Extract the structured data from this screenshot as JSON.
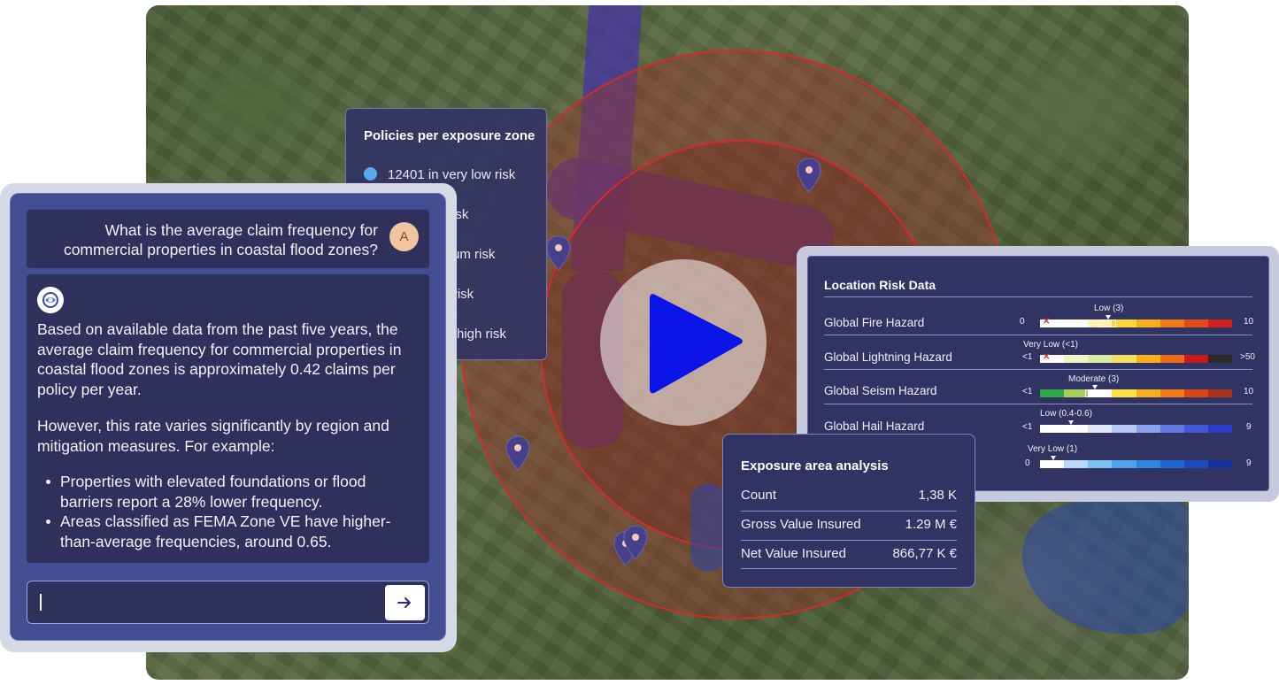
{
  "policies_panel": {
    "title": "Policies per exposure zone",
    "items": [
      {
        "label": "12401 in very low risk",
        "color": "#5aa8f0"
      },
      {
        "label": "w risk"
      },
      {
        "label": "edium risk"
      },
      {
        "label": "gh risk"
      },
      {
        "label": "ery high risk"
      }
    ]
  },
  "chat": {
    "question": "What is the average claim frequency for commercial properties in coastal flood zones?",
    "avatar_initial": "A",
    "answer_p1": "Based on available data from the past five years, the average claim frequency for commercial properties in coastal flood zones is approximately 0.42 claims per policy per year.",
    "answer_p2": "However, this rate varies significantly by region and mitigation measures. For example:",
    "answer_bullets": [
      "Properties with elevated foundations or flood barriers report a 28% lower frequency.",
      "Areas classified as FEMA Zone VE have higher-than-average frequencies, around 0.65."
    ],
    "input_value": "",
    "send_icon": "arrow-right-icon"
  },
  "location_risk": {
    "title": "Location Risk Data",
    "rows": [
      {
        "label": "Global Fire Hazard",
        "caption": "Low (3)",
        "min": "0",
        "max": "10",
        "level": 0.3,
        "colors": [
          "#ffffff",
          "#ffffff",
          "#fff3b0",
          "#ffd640",
          "#f5b01c",
          "#ef7a18",
          "#e44a1a",
          "#d1201a"
        ]
      },
      {
        "label": "Global Lightning Hazard",
        "caption": "Very Low (<1)",
        "min": "<1",
        "max": ">50",
        "level": 0.0,
        "colors": [
          "#ffffff",
          "#eef5c4",
          "#dbeaa0",
          "#f0e060",
          "#f5b01c",
          "#ef6a18",
          "#c81a1a",
          "#2a2a2a"
        ]
      },
      {
        "label": "Global Seism Hazard",
        "caption": "Moderate (3)",
        "min": "<1",
        "max": "10",
        "level": 0.3,
        "colors": [
          "#2ea84a",
          "#a6d05a",
          "#ffffff",
          "#ffe14a",
          "#f5b01c",
          "#ef7a18",
          "#d8451a",
          "#a8321a"
        ]
      },
      {
        "label": "Global Hail Hazard",
        "caption": "Low (0.4-0.6)",
        "min": "<1",
        "max": "9",
        "level": 0.15,
        "colors": [
          "#ffffff",
          "#ffffff",
          "#dfe6f8",
          "#b8c8f4",
          "#8aa0ec",
          "#5f78e2",
          "#3f58d6",
          "#2a3ccc"
        ]
      },
      {
        "label": "",
        "caption": "Very Low (1)",
        "min": "0",
        "max": "9",
        "level": 0.05,
        "colors": [
          "#ffffff",
          "#b9dcf6",
          "#7dbff0",
          "#4ea2e8",
          "#2f86de",
          "#1f68cf",
          "#1a4bb8",
          "#14349a"
        ]
      }
    ]
  },
  "exposure": {
    "title": "Exposure area analysis",
    "rows": [
      {
        "key": "Count",
        "value": "1,38 K"
      },
      {
        "key": "Gross Value Insured",
        "value": "1.29 M €"
      },
      {
        "key": "Net Value Insured",
        "value": "866,77 K €"
      }
    ]
  },
  "map": {
    "pins": [
      "map-pin-icon",
      "map-pin-icon",
      "map-pin-icon",
      "map-pin-icon",
      "map-pin-icon"
    ],
    "play_icon": "play-icon",
    "zone_color": "#d42a2a",
    "flood_color": "#4836a0"
  }
}
